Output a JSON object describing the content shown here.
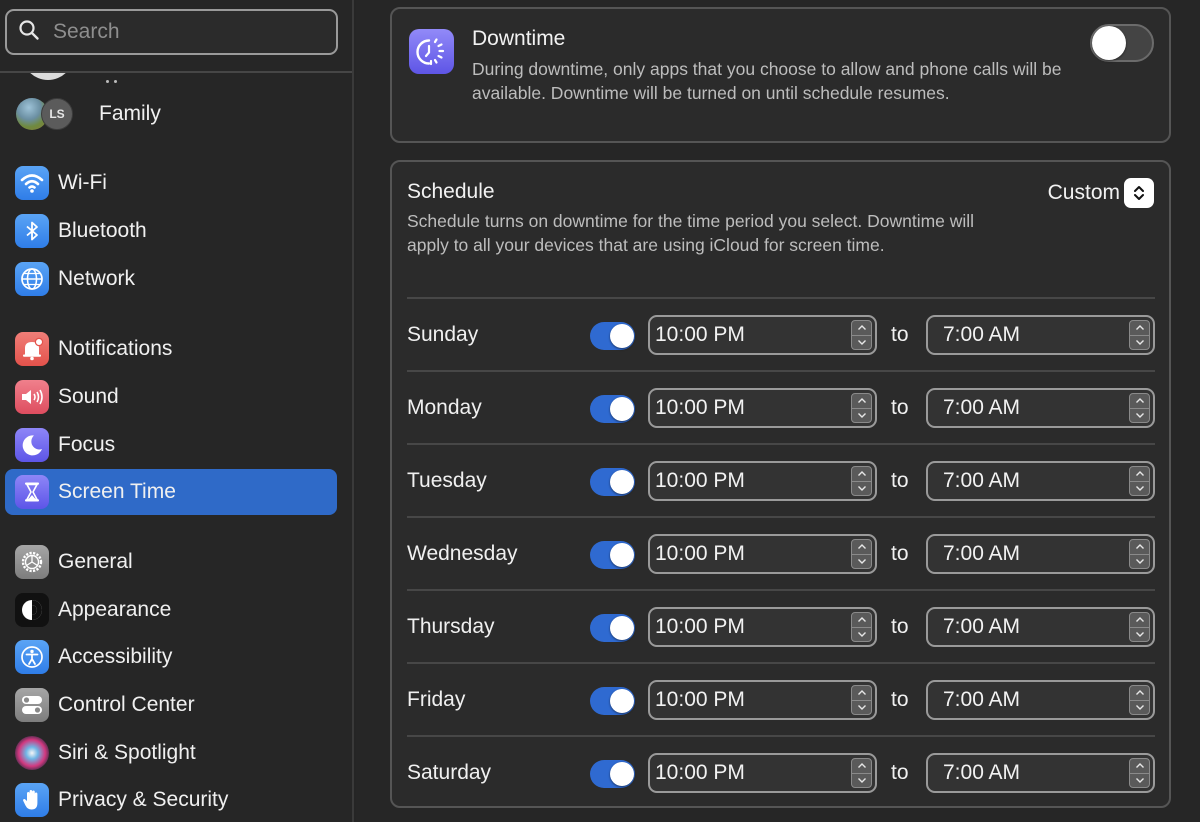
{
  "sidebar": {
    "search": {
      "placeholder": "Search",
      "value": ""
    },
    "family": {
      "label": "Family",
      "member_initials": "LS"
    },
    "groups": [
      [
        {
          "label": "Wi-Fi",
          "icon": "wifi-icon",
          "color": "#3b8df0"
        },
        {
          "label": "Bluetooth",
          "icon": "bluetooth-icon",
          "color": "#3b8df0"
        },
        {
          "label": "Network",
          "icon": "globe-icon",
          "color": "#3b8df0"
        }
      ],
      [
        {
          "label": "Notifications",
          "icon": "bell-icon",
          "color": "#e8605a"
        },
        {
          "label": "Sound",
          "icon": "speaker-icon",
          "color": "#e35a6a"
        },
        {
          "label": "Focus",
          "icon": "moon-icon",
          "color": "#6a62ec"
        },
        {
          "label": "Screen Time",
          "icon": "hourglass-icon",
          "color": "#6a62ec",
          "selected": true
        }
      ],
      [
        {
          "label": "General",
          "icon": "gear-icon",
          "color": "#8e8e8e"
        },
        {
          "label": "Appearance",
          "icon": "appearance-icon",
          "color": "#111111"
        },
        {
          "label": "Accessibility",
          "icon": "accessibility-icon",
          "color": "#3b8df0"
        },
        {
          "label": "Control Center",
          "icon": "control-center-icon",
          "color": "#8e8e8e"
        },
        {
          "label": "Siri & Spotlight",
          "icon": "siri-icon",
          "color": "#d2387f"
        },
        {
          "label": "Privacy & Security",
          "icon": "hand-icon",
          "color": "#3b8df0"
        }
      ]
    ]
  },
  "downtime": {
    "title": "Downtime",
    "description": "During downtime, only apps that you choose to allow and phone calls will be available. Downtime will be turned on until schedule resumes.",
    "enabled": false
  },
  "schedule": {
    "title": "Schedule",
    "description": "Schedule turns on downtime for the time period you select. Downtime will apply to all your devices that are using iCloud for screen time.",
    "mode": "Custom",
    "to_label": "to",
    "days": [
      {
        "day": "Sunday",
        "enabled": true,
        "from": "10:00 PM",
        "to": "7:00 AM"
      },
      {
        "day": "Monday",
        "enabled": true,
        "from": "10:00 PM",
        "to": "7:00 AM"
      },
      {
        "day": "Tuesday",
        "enabled": true,
        "from": "10:00 PM",
        "to": "7:00 AM"
      },
      {
        "day": "Wednesday",
        "enabled": true,
        "from": "10:00 PM",
        "to": "7:00 AM"
      },
      {
        "day": "Thursday",
        "enabled": true,
        "from": "10:00 PM",
        "to": "7:00 AM"
      },
      {
        "day": "Friday",
        "enabled": true,
        "from": "10:00 PM",
        "to": "7:00 AM"
      },
      {
        "day": "Saturday",
        "enabled": true,
        "from": "10:00 PM",
        "to": "7:00 AM"
      }
    ]
  },
  "colors": {
    "accent": "#2f6ac8",
    "toggle_on": "#2f6ad1",
    "background": "#262626",
    "card": "#2b2b2b"
  }
}
